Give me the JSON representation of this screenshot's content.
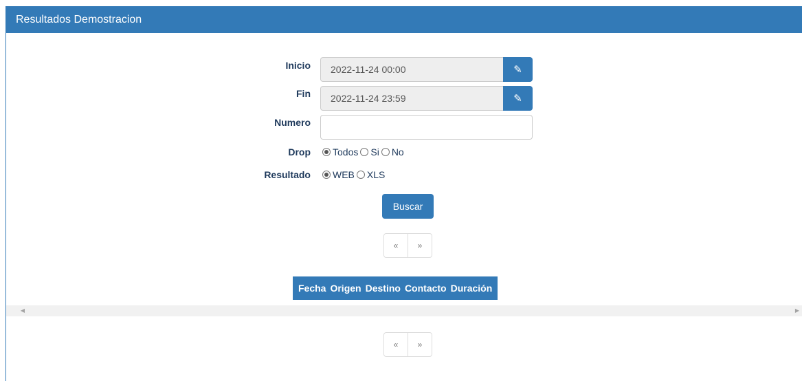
{
  "header": {
    "title": "Resultados Demostracion"
  },
  "form": {
    "inicio": {
      "label": "Inicio",
      "value": "2022-11-24 00:00"
    },
    "fin": {
      "label": "Fin",
      "value": "2022-11-24 23:59"
    },
    "numero": {
      "label": "Numero",
      "value": ""
    },
    "drop": {
      "label": "Drop",
      "options": [
        "Todos",
        "Si",
        "No"
      ],
      "selected": "Todos"
    },
    "resultado": {
      "label": "Resultado",
      "options": [
        "WEB",
        "XLS"
      ],
      "selected": "WEB"
    }
  },
  "buttons": {
    "search_label": "Buscar"
  },
  "pager": {
    "prev": "«",
    "next": "»"
  },
  "table": {
    "headers": [
      "Fecha",
      "Origen",
      "Destino",
      "Contacto",
      "Duración"
    ]
  },
  "icons": {
    "edit": "pencil-icon",
    "scroll_left": "arrow-left-icon",
    "scroll_right": "arrow-right-icon"
  },
  "colors": {
    "primary": "#337ab7"
  }
}
